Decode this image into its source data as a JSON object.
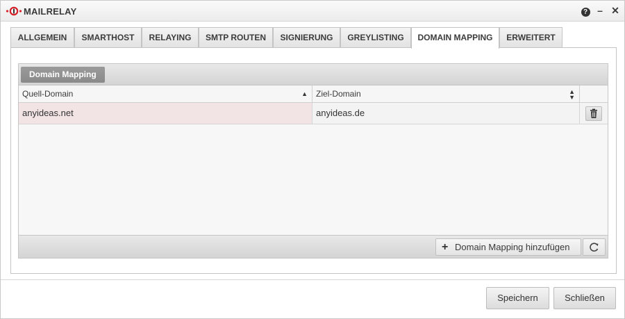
{
  "window": {
    "title": "MAILRELAY",
    "help_label": "?",
    "minimize_label": "–",
    "close_label": "✕"
  },
  "tabs": [
    {
      "label": "ALLGEMEIN",
      "active": false
    },
    {
      "label": "SMARTHOST",
      "active": false
    },
    {
      "label": "RELAYING",
      "active": false
    },
    {
      "label": "SMTP ROUTEN",
      "active": false
    },
    {
      "label": "SIGNIERUNG",
      "active": false
    },
    {
      "label": "GREYLISTING",
      "active": false
    },
    {
      "label": "DOMAIN MAPPING",
      "active": true
    },
    {
      "label": "ERWEITERT",
      "active": false
    }
  ],
  "grid": {
    "title": "Domain Mapping",
    "columns": [
      "Quell-Domain",
      "Ziel-Domain"
    ],
    "rows": [
      {
        "source": "anyideas.net",
        "target": "anyideas.de"
      }
    ],
    "add_label": "Domain Mapping hinzufügen"
  },
  "footer": {
    "save_label": "Speichern",
    "close_label": "Schließen"
  },
  "colors": {
    "accent": "#d6202a",
    "row_highlight": "#f2e4e4"
  }
}
